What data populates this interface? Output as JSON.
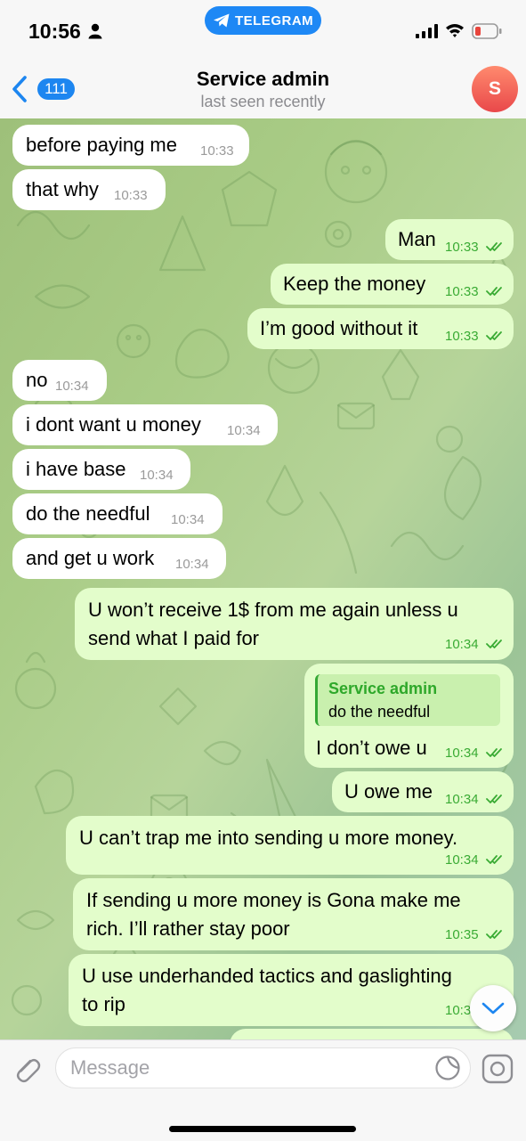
{
  "status_bar": {
    "time": "10:56",
    "return_app": "TELEGRAM"
  },
  "header": {
    "back_count": "111",
    "title": "Service admin",
    "subtitle": "last seen recently",
    "avatar_initial": "S"
  },
  "messages": [
    {
      "dir": "in",
      "lines": [
        "before paying me"
      ],
      "time": "10:33"
    },
    {
      "dir": "in",
      "lines": [
        "that why"
      ],
      "time": "10:33"
    },
    {
      "dir": "out",
      "lines": [
        "Man"
      ],
      "time": "10:33"
    },
    {
      "dir": "out",
      "lines": [
        "Keep the money"
      ],
      "time": "10:33"
    },
    {
      "dir": "out",
      "lines": [
        "I’m good without it"
      ],
      "time": "10:33"
    },
    {
      "dir": "in",
      "lines": [
        "no"
      ],
      "time": "10:34"
    },
    {
      "dir": "in",
      "lines": [
        "i dont want u money"
      ],
      "time": "10:34"
    },
    {
      "dir": "in",
      "lines": [
        "i have base"
      ],
      "time": "10:34"
    },
    {
      "dir": "in",
      "lines": [
        "do the needful"
      ],
      "time": "10:34"
    },
    {
      "dir": "in",
      "lines": [
        "and get u work"
      ],
      "time": "10:34"
    },
    {
      "dir": "out",
      "lines": [
        "U won’t receive 1$ from me again unless u",
        "send what I paid for"
      ],
      "time": "10:34"
    },
    {
      "dir": "out",
      "reply_to": {
        "name": "Service admin",
        "text": "do the needful"
      },
      "lines": [
        "I don’t owe u"
      ],
      "time": "10:34"
    },
    {
      "dir": "out",
      "lines": [
        "U owe me"
      ],
      "time": "10:34"
    },
    {
      "dir": "out",
      "lines": [
        "U can’t trap me into sending u more money."
      ],
      "time": "10:34"
    },
    {
      "dir": "out",
      "lines": [
        "If sending u more money is Gona make me",
        "rich.  I’ll rather stay poor"
      ],
      "time": "10:35"
    },
    {
      "dir": "out",
      "lines": [
        "U use underhanded tactics and gaslighting",
        "to rip"
      ],
      "time": "10:3"
    }
  ],
  "composer": {
    "placeholder": "Message"
  },
  "icons": [
    "person-icon",
    "telegram-plane-icon",
    "signal-icon",
    "wifi-icon",
    "battery-icon",
    "chevron-left-icon",
    "paperclip-icon",
    "sticker-icon",
    "camera-icon",
    "chevron-down-icon",
    "double-check-icon"
  ],
  "colors": {
    "accent": "#1e88f5",
    "outgoing_bubble": "#e3fdcb",
    "incoming_bubble": "#ffffff",
    "read_check": "#3aab34",
    "battery_low": "#e8453c"
  }
}
